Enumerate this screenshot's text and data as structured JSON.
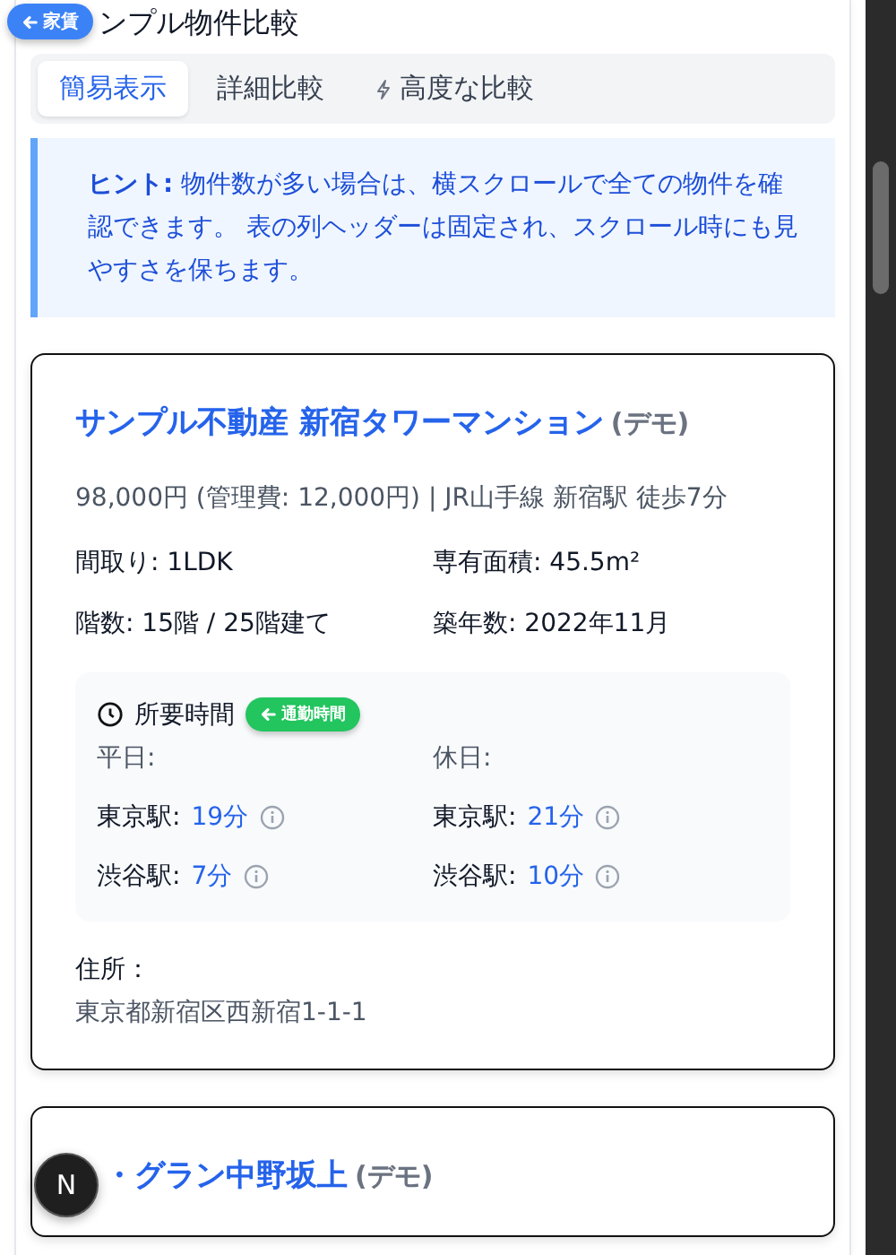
{
  "back_badge": {
    "label": "家賃"
  },
  "page_title": "ンプル物件比較",
  "tabs": [
    {
      "label": "簡易表示",
      "selected": true,
      "kind": "plain"
    },
    {
      "label": "詳細比較",
      "selected": false,
      "kind": "plain"
    },
    {
      "label": "高度な比較",
      "selected": false,
      "kind": "bolt"
    }
  ],
  "hint": {
    "label": "ヒント:",
    "text": "物件数が多い場合は、横スクロールで全ての物件を確認できます。 表の列ヘッダーは固定され、スクロール時にも見やすさを保ちます。"
  },
  "properties": [
    {
      "name": "サンプル不動産 新宿タワーマンション",
      "tag": "(デモ)",
      "summary": "98,000円 (管理費: 12,000円) | JR山手線 新宿駅 徒歩7分",
      "specs": [
        "間取り: 1LDK",
        "専有面積: 45.5m²",
        "階数: 15階 / 25階建て",
        "築年数: 2022年11月"
      ],
      "commute": {
        "title": "所要時間",
        "badge": "通勤時間",
        "columns": [
          {
            "heading": "平日:",
            "rows": [
              {
                "station": "東京駅:",
                "time": "19分"
              },
              {
                "station": "渋谷駅:",
                "time": "7分"
              }
            ]
          },
          {
            "heading": "休日:",
            "rows": [
              {
                "station": "東京駅:",
                "time": "21分"
              },
              {
                "station": "渋谷駅:",
                "time": "10分"
              }
            ]
          }
        ]
      },
      "address_label": "住所：",
      "address": "東京都新宿区西新宿1-1-1"
    },
    {
      "name": "・グラン中野坂上",
      "tag": "(デモ)"
    }
  ],
  "floating_button": {
    "label": "N"
  }
}
